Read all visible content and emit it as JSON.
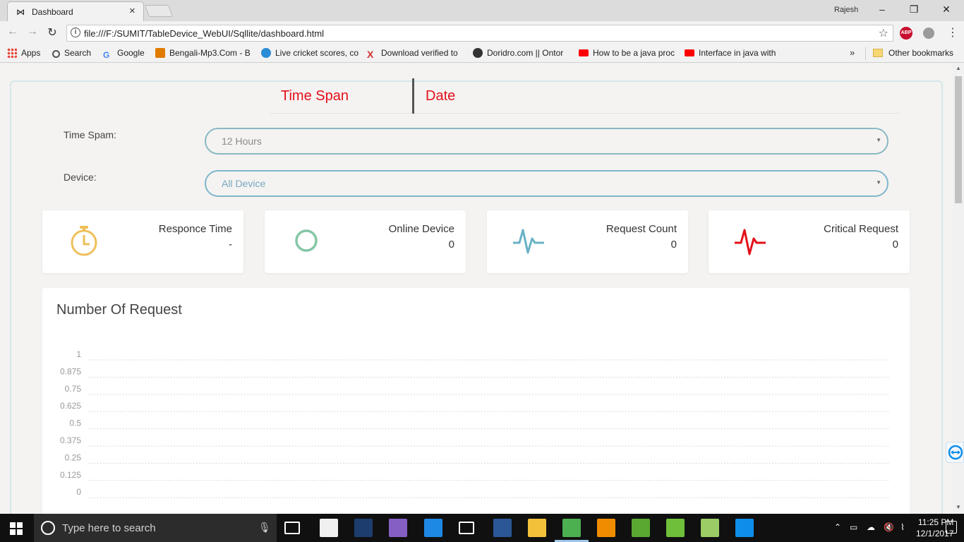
{
  "browser": {
    "tab_title": "Dashboard",
    "tab_close": "×",
    "profile_name": "Rajesh",
    "url": "file:///F:/SUMIT/TableDevice_WebUI/Sqllite/dashboard.html",
    "ext_abp": "ABP",
    "bookmarks": [
      {
        "label": "Apps",
        "icon": "apps-grid-icon",
        "color": "#e94235"
      },
      {
        "label": "Search",
        "icon": "search-icon",
        "color": "#555555"
      },
      {
        "label": "Google",
        "icon": "google-icon",
        "color": "#4285f4"
      },
      {
        "label": "Bengali-Mp3.Com - B",
        "icon": "music-icon",
        "color": "#e07b00"
      },
      {
        "label": "Live cricket scores, co",
        "icon": "globe-icon",
        "color": "#2a8bd6"
      },
      {
        "label": "Download verified to",
        "icon": "x-icon",
        "color": "#d32f2f"
      },
      {
        "label": "Doridro.com || Ontor",
        "icon": "doridro-icon",
        "color": "#333333"
      },
      {
        "label": "How to be a java proc",
        "icon": "youtube-icon",
        "color": "#ff0000"
      },
      {
        "label": "Interface in java with",
        "icon": "youtube-icon",
        "color": "#ff0000"
      }
    ],
    "bookmarks_more": "»",
    "other_bookmarks": "Other bookmarks"
  },
  "page": {
    "tabs": [
      "Time Span",
      "Date"
    ],
    "time_span_label": "Time Spam:",
    "time_span_value": "12 Hours",
    "device_label": "Device:",
    "device_value": "All Device",
    "accent_color": "#e4101a",
    "cards": [
      {
        "title": "Responce Time",
        "value": "-",
        "icon": "stopwatch-icon",
        "color": "#eec05a"
      },
      {
        "title": "Online Device",
        "value": "0",
        "icon": "circle-icon",
        "color": "#86c6a6"
      },
      {
        "title": "Request Count",
        "value": "0",
        "icon": "pulse-icon",
        "color": "#69b2c6"
      },
      {
        "title": "Critical Request",
        "value": "0",
        "icon": "heartbeat-icon",
        "color": "#e4101a"
      }
    ],
    "chart_title": "Number Of Request"
  },
  "chart_data": {
    "type": "line",
    "title": "Number Of Request",
    "xlabel": "",
    "ylabel": "",
    "ylim": [
      0,
      1
    ],
    "y_ticks": [
      "1",
      "0.875",
      "0.75",
      "0.625",
      "0.5",
      "0.375",
      "0.25",
      "0.125",
      "0"
    ],
    "series": [],
    "grid": true,
    "grid_style": "dotted"
  },
  "taskbar": {
    "search_placeholder": "Type here to search",
    "time": "11:25 PM",
    "date": "12/1/2017",
    "apps": [
      {
        "name": "task-view-icon",
        "color": "#ffffff"
      },
      {
        "name": "store-icon",
        "color": "#f0f0f0"
      },
      {
        "name": "photoshop-icon",
        "color": "#1c3d6e"
      },
      {
        "name": "visual-studio-icon",
        "color": "#865fc5"
      },
      {
        "name": "edge-icon",
        "color": "#1e88e5"
      },
      {
        "name": "mail-icon",
        "color": "#ffffff"
      },
      {
        "name": "word-icon",
        "color": "#2b5797"
      },
      {
        "name": "file-explorer-icon",
        "color": "#f3c13a"
      },
      {
        "name": "chrome-icon",
        "color": "#4caf50"
      },
      {
        "name": "vlc-icon",
        "color": "#f08c00"
      },
      {
        "name": "green-app-icon",
        "color": "#5aa832"
      },
      {
        "name": "utorrent-icon",
        "color": "#6fbf3a"
      },
      {
        "name": "notepad-plus-icon",
        "color": "#9ccc65"
      },
      {
        "name": "teamviewer-icon",
        "color": "#0e8ee9"
      }
    ]
  }
}
